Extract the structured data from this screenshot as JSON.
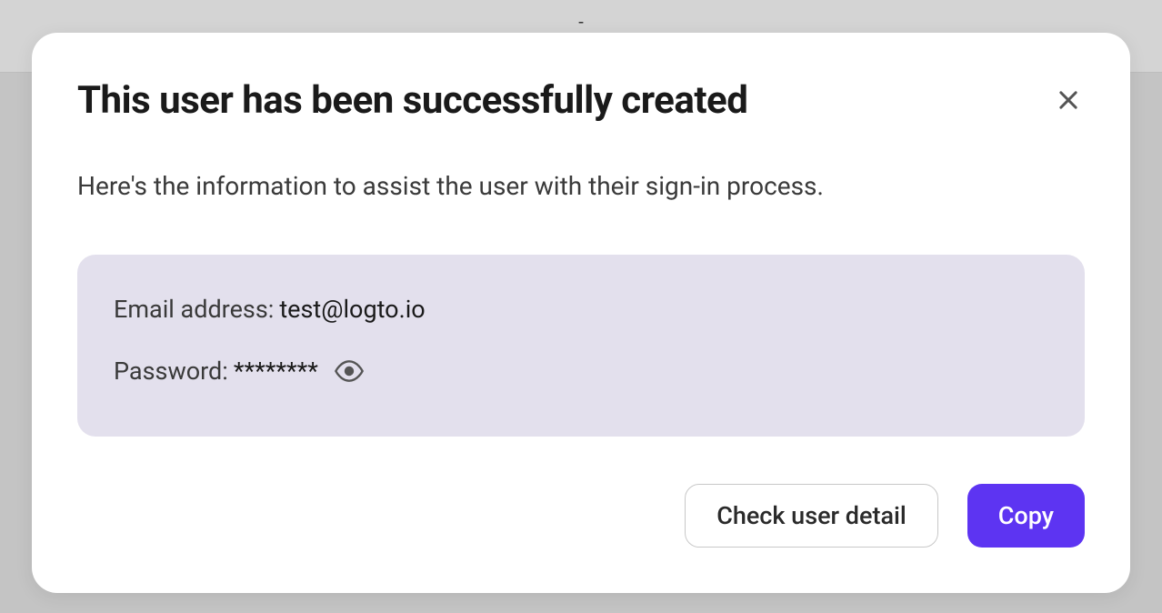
{
  "modal": {
    "title": "This user has been successfully created",
    "description": "Here's the information to assist the user with their sign-in process.",
    "info": {
      "email_label": "Email address:",
      "email_value": "test@logto.io",
      "password_label": "Password:",
      "password_value": "********"
    },
    "buttons": {
      "check_detail": "Check user detail",
      "copy": "Copy"
    }
  }
}
